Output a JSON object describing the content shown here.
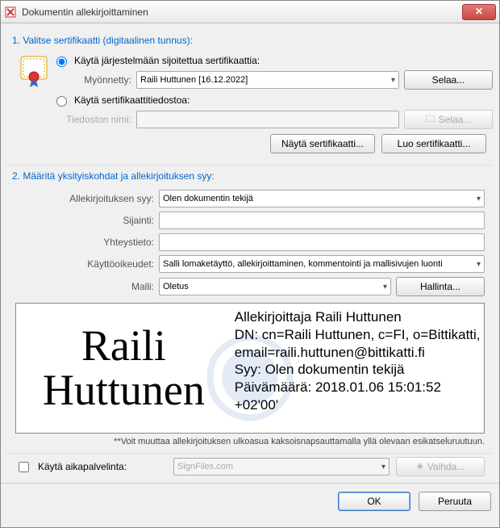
{
  "window": {
    "title": "Dokumentin allekirjoittaminen"
  },
  "section1": {
    "title": "1. Valitse sertifikaatti (digitaalinen tunnus):",
    "radio_system": "Käytä järjestelmään sijoitettua sertifikaattia:",
    "issued_label": "Myönnetty:",
    "issued_value": "Raili Huttunen [16.12.2022]",
    "browse": "Selaa...",
    "radio_file": "Käytä sertifikaattitiedostoa:",
    "file_label": "Tiedoston nimi:",
    "file_value": "",
    "browse2": "Selaa...",
    "show_cert": "Näytä sertifikaatti...",
    "create_cert": "Luo sertifikaatti..."
  },
  "section2": {
    "title": "2. Määritä yksityiskohdat ja allekirjoituksen syy:",
    "reason_label": "Allekirjoituksen syy:",
    "reason_value": "Olen dokumentin tekijä",
    "location_label": "Sijainti:",
    "location_value": "",
    "contact_label": "Yhteystieto:",
    "contact_value": "",
    "perm_label": "Käyttöoikeudet:",
    "perm_value": "Salli lomaketäyttö, allekirjoittaminen, kommentointi ja mallisivujen luonti",
    "template_label": "Malli:",
    "template_value": "Oletus",
    "manage": "Hallinta..."
  },
  "preview": {
    "name": "Raili Huttunen",
    "line1": "Allekirjoittaja Raili Huttunen",
    "line2": "DN: cn=Raili Huttunen, c=FI, o=Bittikatti, email=raili.huttunen@bittikatti.fi",
    "line3": "Syy: Olen dokumentin tekijä",
    "line4": "Päivämäärä: 2018.01.06 15:01:52 +02'00'"
  },
  "hint": "**Voit muuttaa allekirjoituksen ulkoasua kaksoisnapsauttamalla yllä olevaan esikatseluruutuun.",
  "timeserver": {
    "checkbox_label": "Käytä aikapalvelinta:",
    "value": "SignFiles.com",
    "change": "Vaihda..."
  },
  "footer": {
    "ok": "OK",
    "cancel": "Peruuta"
  }
}
